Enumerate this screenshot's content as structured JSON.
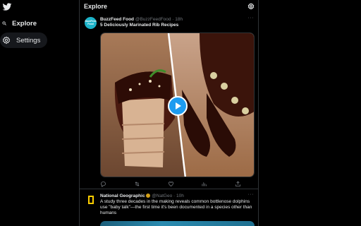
{
  "nav": {
    "explore_label": "Explore",
    "settings_label": "Settings"
  },
  "topbar": {
    "title": "Explore"
  },
  "tweets": [
    {
      "avatar_text": "BuzzFeed Food",
      "name": "BuzzFeed Food",
      "handle": "@BuzzFeedFood · 18h",
      "text": "5 Deliciously Marinated Rib Recipes",
      "more": "···"
    },
    {
      "name": "National Geographic",
      "handle": "@NatGeo · 10h",
      "text": "A study three decades in the making reveals common bottlenose dolphins use \"baby talk\"—the first time it's been documented in a species other than humans",
      "more": "···"
    }
  ],
  "icons": {
    "logo": "twitter-bird-icon",
    "explore": "search-icon",
    "settings": "gear-icon",
    "topbar_settings": "gear-icon",
    "play": "play-icon",
    "reply": "reply-icon",
    "retweet": "retweet-icon",
    "like": "heart-icon",
    "views": "bar-chart-icon",
    "share": "share-icon"
  },
  "colors": {
    "background": "#000000",
    "text": "#e7e9ea",
    "muted": "#71767b",
    "accent": "#1d9bf0",
    "border": "#2f3336"
  }
}
